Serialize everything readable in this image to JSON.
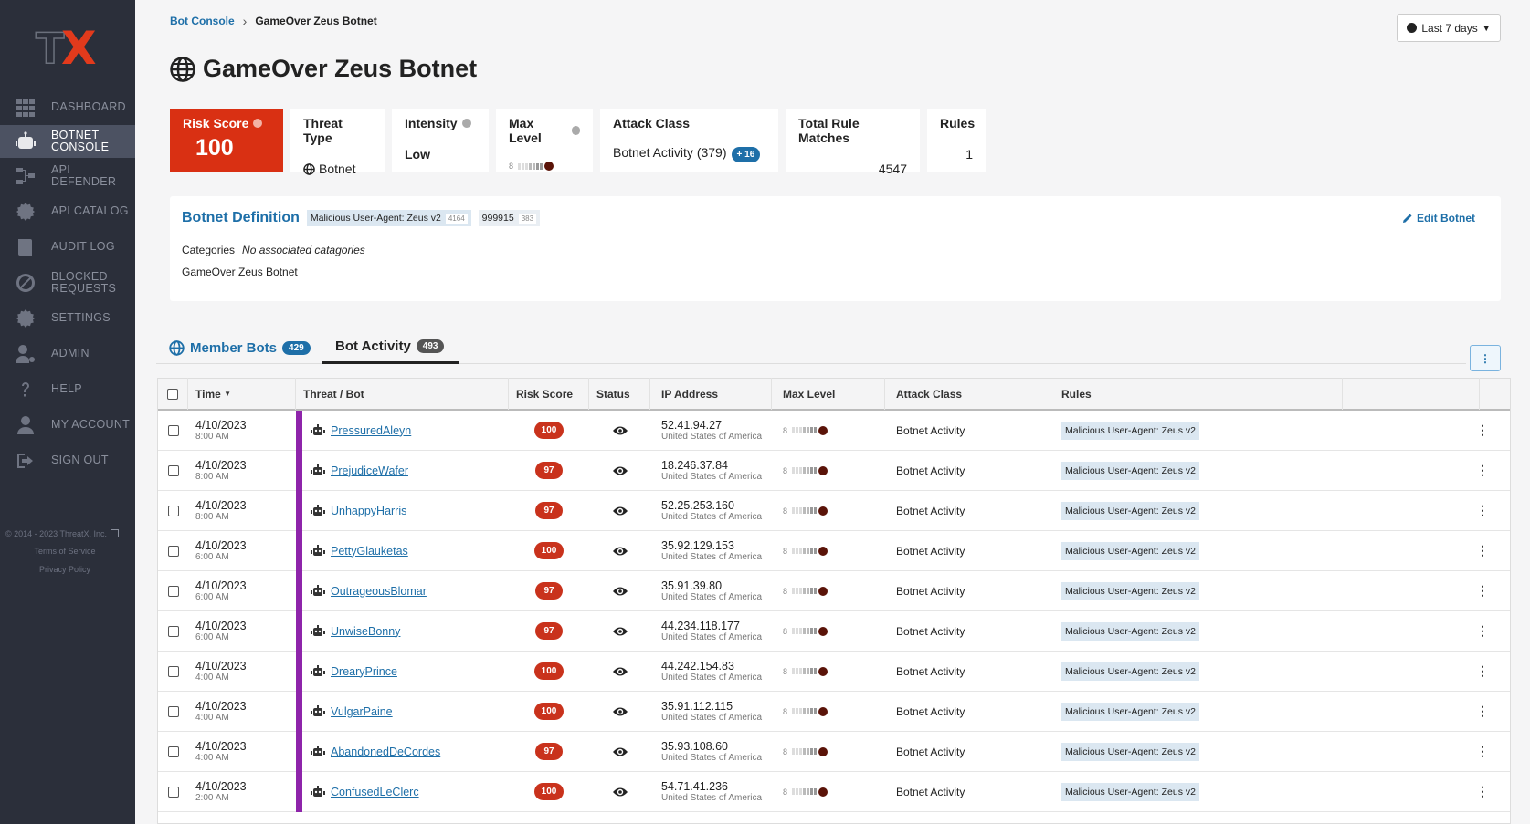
{
  "logo": {
    "t": "T",
    "x": "X"
  },
  "nav": [
    {
      "label": "Dashboard",
      "icon": "dashboard-grid-icon",
      "active": false
    },
    {
      "label": "Botnet Console",
      "icon": "robot-icon",
      "active": true
    },
    {
      "label": "API Defender",
      "icon": "network-icon",
      "active": false
    },
    {
      "label": "API Catalog",
      "icon": "gear-catalog-icon",
      "active": false
    },
    {
      "label": "Audit Log",
      "icon": "book-icon",
      "active": false
    },
    {
      "label": "Blocked Requests",
      "icon": "ban-icon",
      "active": false
    },
    {
      "label": "Settings",
      "icon": "gear-icon",
      "active": false
    },
    {
      "label": "Admin",
      "icon": "user-gear-icon",
      "active": false
    },
    {
      "label": "Help",
      "icon": "question-icon",
      "active": false
    },
    {
      "label": "My Account",
      "icon": "user-icon",
      "active": false
    },
    {
      "label": "Sign Out",
      "icon": "sign-out-icon",
      "active": false
    }
  ],
  "sidebar_footer": {
    "copyright": "© 2014 - 2023 ThreatX, Inc.",
    "terms": "Terms of Service",
    "privacy": "Privacy Policy"
  },
  "breadcrumb": {
    "parent": "Bot Console",
    "current": "GameOver Zeus Botnet"
  },
  "range": {
    "label": "Last 7 days"
  },
  "title": "GameOver Zeus Botnet",
  "stats": {
    "risk": {
      "label": "Risk Score",
      "value": "100"
    },
    "threat_type": {
      "label": "Threat Type",
      "value": "Botnet"
    },
    "intensity": {
      "label": "Intensity",
      "value": "Low"
    },
    "max_level": {
      "label": "Max Level",
      "value": "8"
    },
    "attack_class": {
      "label": "Attack Class",
      "value": "Botnet Activity (379)",
      "extra": "+ 16"
    },
    "total_rule_matches": {
      "label": "Total Rule Matches",
      "value": "4547"
    },
    "rules": {
      "label": "Rules",
      "value": "1"
    }
  },
  "definition": {
    "title": "Botnet Definition",
    "chips": [
      {
        "label": "Malicious User-Agent: Zeus v2",
        "count": "4164"
      },
      {
        "label": "999915",
        "count": "383"
      }
    ],
    "edit_label": "Edit Botnet",
    "categories_label": "Categories",
    "categories_value": "No associated catagories",
    "description": "GameOver Zeus Botnet"
  },
  "tabs": [
    {
      "label": "Member Bots",
      "count": "429"
    },
    {
      "label": "Bot Activity",
      "count": "493"
    }
  ],
  "table": {
    "headers": {
      "time": "Time",
      "threat": "Threat / Bot",
      "risk": "Risk Score",
      "status": "Status",
      "ip": "IP Address",
      "level": "Max Level",
      "attack": "Attack Class",
      "rules": "Rules"
    },
    "rows": [
      {
        "date": "4/10/2023",
        "time": "8:00 AM",
        "bot": "PressuredAleyn",
        "risk": "100",
        "ip": "52.41.94.27",
        "country": "United States of America",
        "level": "8",
        "attack": "Botnet Activity",
        "rule": "Malicious User-Agent: Zeus v2"
      },
      {
        "date": "4/10/2023",
        "time": "8:00 AM",
        "bot": "PrejudiceWafer",
        "risk": "97",
        "ip": "18.246.37.84",
        "country": "United States of America",
        "level": "8",
        "attack": "Botnet Activity",
        "rule": "Malicious User-Agent: Zeus v2"
      },
      {
        "date": "4/10/2023",
        "time": "8:00 AM",
        "bot": "UnhappyHarris",
        "risk": "97",
        "ip": "52.25.253.160",
        "country": "United States of America",
        "level": "8",
        "attack": "Botnet Activity",
        "rule": "Malicious User-Agent: Zeus v2"
      },
      {
        "date": "4/10/2023",
        "time": "6:00 AM",
        "bot": "PettyGlauketas",
        "risk": "100",
        "ip": "35.92.129.153",
        "country": "United States of America",
        "level": "8",
        "attack": "Botnet Activity",
        "rule": "Malicious User-Agent: Zeus v2"
      },
      {
        "date": "4/10/2023",
        "time": "6:00 AM",
        "bot": "OutrageousBlomar",
        "risk": "97",
        "ip": "35.91.39.80",
        "country": "United States of America",
        "level": "8",
        "attack": "Botnet Activity",
        "rule": "Malicious User-Agent: Zeus v2"
      },
      {
        "date": "4/10/2023",
        "time": "6:00 AM",
        "bot": "UnwiseBonny",
        "risk": "97",
        "ip": "44.234.118.177",
        "country": "United States of America",
        "level": "8",
        "attack": "Botnet Activity",
        "rule": "Malicious User-Agent: Zeus v2"
      },
      {
        "date": "4/10/2023",
        "time": "4:00 AM",
        "bot": "DrearyPrince",
        "risk": "100",
        "ip": "44.242.154.83",
        "country": "United States of America",
        "level": "8",
        "attack": "Botnet Activity",
        "rule": "Malicious User-Agent: Zeus v2"
      },
      {
        "date": "4/10/2023",
        "time": "4:00 AM",
        "bot": "VulgarPaine",
        "risk": "100",
        "ip": "35.91.112.115",
        "country": "United States of America",
        "level": "8",
        "attack": "Botnet Activity",
        "rule": "Malicious User-Agent: Zeus v2"
      },
      {
        "date": "4/10/2023",
        "time": "4:00 AM",
        "bot": "AbandonedDeCordes",
        "risk": "97",
        "ip": "35.93.108.60",
        "country": "United States of America",
        "level": "8",
        "attack": "Botnet Activity",
        "rule": "Malicious User-Agent: Zeus v2"
      },
      {
        "date": "4/10/2023",
        "time": "2:00 AM",
        "bot": "ConfusedLeClerc",
        "risk": "100",
        "ip": "54.71.41.236",
        "country": "United States of America",
        "level": "8",
        "attack": "Botnet Activity",
        "rule": "Malicious User-Agent: Zeus v2"
      }
    ]
  },
  "colors": {
    "sidebar": "#2b2f3a",
    "accent": "#1e6fa8",
    "risk": "#d93013",
    "low": "#4aa62c",
    "bot_stripe": "#8e24aa"
  }
}
